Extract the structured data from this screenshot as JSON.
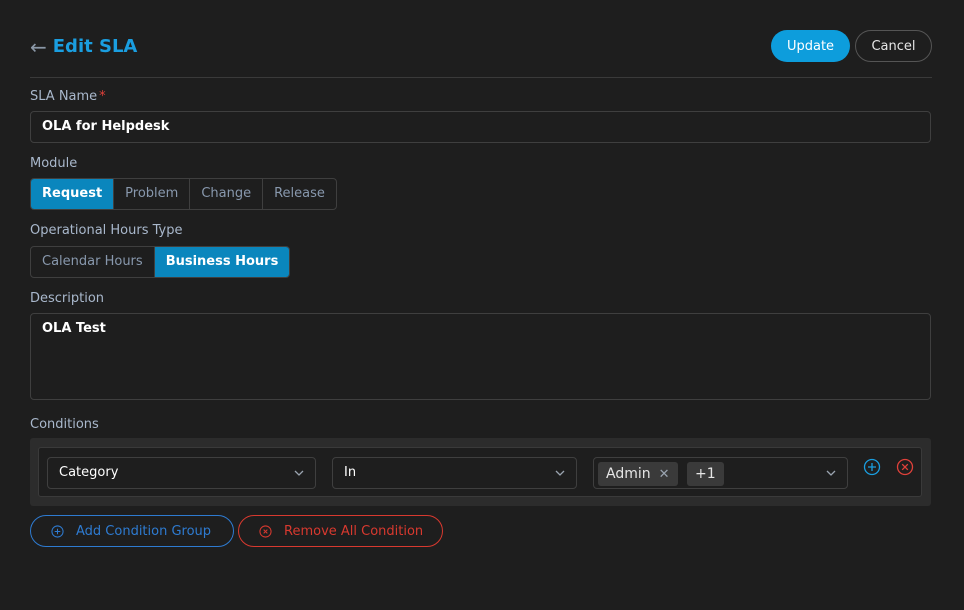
{
  "header": {
    "back_icon": "arrow-left-icon",
    "title": "Edit SLA",
    "update_label": "Update",
    "cancel_label": "Cancel"
  },
  "form": {
    "sla_name": {
      "label": "SLA Name",
      "required_mark": "*",
      "value": "OLA for Helpdesk"
    },
    "module": {
      "label": "Module",
      "options": [
        "Request",
        "Problem",
        "Change",
        "Release"
      ],
      "selected": "Request"
    },
    "operational_hours_type": {
      "label": "Operational Hours Type",
      "options": [
        "Calendar Hours",
        "Business Hours"
      ],
      "selected": "Business Hours"
    },
    "description": {
      "label": "Description",
      "value": "OLA Test"
    },
    "conditions": {
      "label": "Conditions",
      "rows": [
        {
          "field": "Category",
          "operator": "In",
          "values": [
            "Admin"
          ],
          "more_count": "+1"
        }
      ],
      "add_condition_group_label": "Add Condition Group",
      "remove_all_label": "Remove All Condition"
    }
  },
  "colors": {
    "accent": "#0d9ddc",
    "active_segment": "#0a86bd",
    "danger": "#d8392f",
    "link_blue": "#2e7bd1",
    "background": "#1e1e1e"
  }
}
